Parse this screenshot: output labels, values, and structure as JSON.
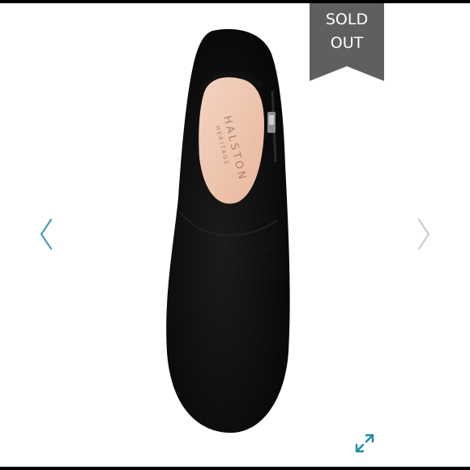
{
  "badge": {
    "line1": "SOLD",
    "line2": "OUT",
    "color": "#5f5f5f"
  },
  "product_image": {
    "brand_line1": "HALSTON",
    "brand_line2": "HERITAGE"
  },
  "controls": {
    "prev_icon": "chevron-left-icon",
    "next_icon": "chevron-right-icon",
    "expand_icon": "expand-icon",
    "prev_color": "#4a9bb0",
    "next_color": "#cccccc",
    "expand_color": "#1f8ba3"
  }
}
